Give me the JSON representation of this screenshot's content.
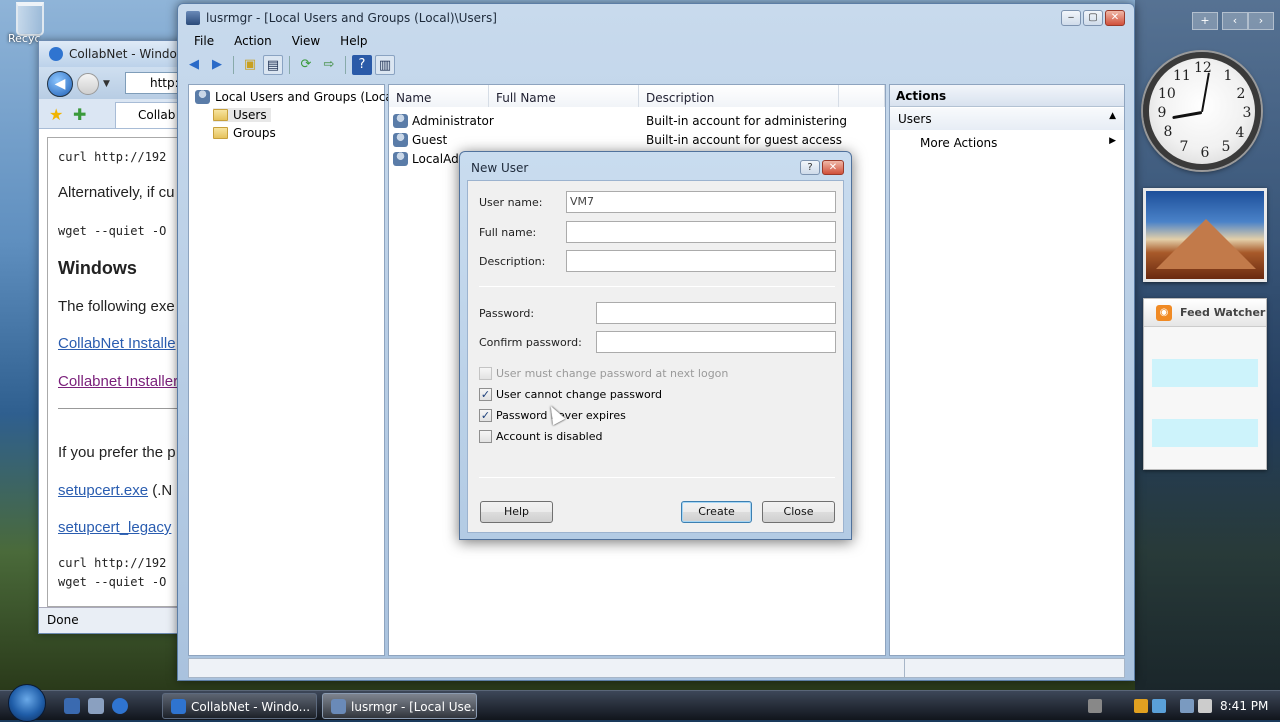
{
  "desktop": {
    "recycle_label": "Recyc",
    "feed_title": "Feed Watcher",
    "clock_numbers": [
      "12",
      "1",
      "2",
      "3",
      "4",
      "5",
      "6",
      "7",
      "8",
      "9",
      "10",
      "11"
    ],
    "sidebar_buttons": [
      "+",
      "‹",
      "›"
    ]
  },
  "ie": {
    "title": "CollabNet - Window",
    "address": "http:",
    "tab_label": "Collab",
    "lines": {
      "curl1": "curl http://192",
      "alt": "Alternatively, if cu",
      "wget1": "wget --quiet -O",
      "heading": "Windows",
      "following": "The following exe",
      "link1": "CollabNet Installe",
      "link2": "Collabnet Installer",
      "prefer": "If you prefer the p",
      "setup1": "setupcert.exe",
      "setup1_suffix": " (.N",
      "setup2": "setupcert_legacy",
      "curl2": "curl http://192",
      "wget2": "wget --quiet -O"
    },
    "status": "Done"
  },
  "mmc": {
    "title": "lusrmgr - [Local Users and Groups (Local)\\Users]",
    "menu": [
      "File",
      "Action",
      "View",
      "Help"
    ],
    "tree": {
      "root": "Local Users and Groups (Local)",
      "children": [
        "Users",
        "Groups"
      ]
    },
    "columns": [
      "Name",
      "Full Name",
      "Description"
    ],
    "rows": [
      {
        "name": "Administrator",
        "full": "",
        "desc": "Built-in account for administering..."
      },
      {
        "name": "Guest",
        "full": "",
        "desc": "Built-in account for guest access t..."
      },
      {
        "name": "LocalAdm",
        "full": "",
        "desc": ""
      }
    ],
    "actions": {
      "header": "Actions",
      "section": "Users",
      "item": "More Actions"
    }
  },
  "dialog": {
    "title": "New User",
    "help_glyph": "?",
    "close_glyph": "✕",
    "labels": {
      "username": "User name:",
      "fullname": "Full name:",
      "description": "Description:",
      "password": "Password:",
      "confirm": "Confirm password:"
    },
    "values": {
      "username": "VM7",
      "fullname": "",
      "description": "",
      "password": "",
      "confirm": ""
    },
    "checks": {
      "must_change": "User must change password at next logon",
      "cannot_change": "User cannot change password",
      "never_expires": "Password never expires",
      "disabled": "Account is disabled"
    },
    "checked": {
      "must_change": false,
      "cannot_change": true,
      "never_expires": true,
      "disabled": false
    },
    "buttons": {
      "help": "Help",
      "create": "Create",
      "close": "Close"
    }
  },
  "taskbar": {
    "tasks": [
      "CollabNet - Windo...",
      "lusrmgr - [Local Use..."
    ],
    "time": "8:41 PM"
  },
  "colors": {
    "accent": "#3c7fb1",
    "selection": "#cdf3fb",
    "link": "#2a5db0"
  }
}
